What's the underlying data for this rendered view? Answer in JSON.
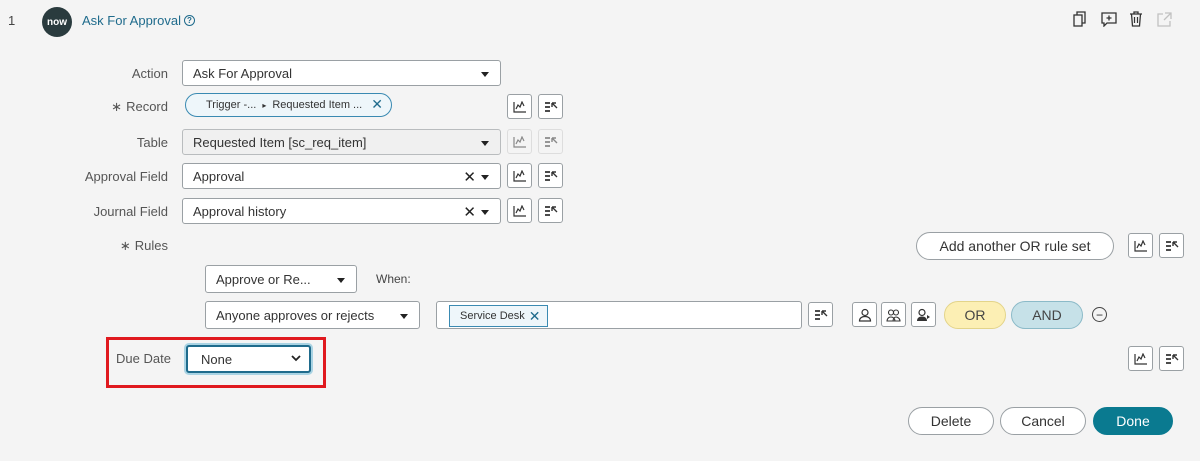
{
  "step": {
    "number": "1",
    "logo": "now",
    "title": "Ask For Approval",
    "help_icon": "?"
  },
  "top_icons": [
    "copy-icon",
    "add-comment-icon",
    "trash-icon",
    "open-external-icon"
  ],
  "fields": {
    "action": {
      "label": "Action",
      "value": "Ask For Approval"
    },
    "record": {
      "label": "Record",
      "required_mark": "∗",
      "pill": {
        "part1": "Trigger -...",
        "sep": "▸",
        "part2": "Requested Item ...",
        "clear": "✕"
      }
    },
    "table": {
      "label": "Table",
      "value": "Requested Item [sc_req_item]"
    },
    "approval_field": {
      "label": "Approval Field",
      "value": "Approval",
      "clear": "✕"
    },
    "journal_field": {
      "label": "Journal Field",
      "value": "Approval history",
      "clear": "✕"
    },
    "rules": {
      "label": "Rules",
      "required_mark": "∗"
    }
  },
  "rules": {
    "add_or_ruleset": "Add another OR rule set",
    "approve_select": "Approve or Re...",
    "when_label": "When:",
    "condition_select": "Anyone approves or rejects",
    "tag": "Service Desk",
    "tag_clear": "✕",
    "or_button": "OR",
    "and_button": "AND",
    "remove_icon": "−"
  },
  "due_date": {
    "label": "Due Date",
    "value": "None"
  },
  "footer": {
    "delete": "Delete",
    "cancel": "Cancel",
    "done": "Done"
  },
  "colors": {
    "accent": "#0a7a90",
    "highlight": "#e0191f",
    "or": "#fcefb4",
    "and": "#c6e1e8"
  }
}
